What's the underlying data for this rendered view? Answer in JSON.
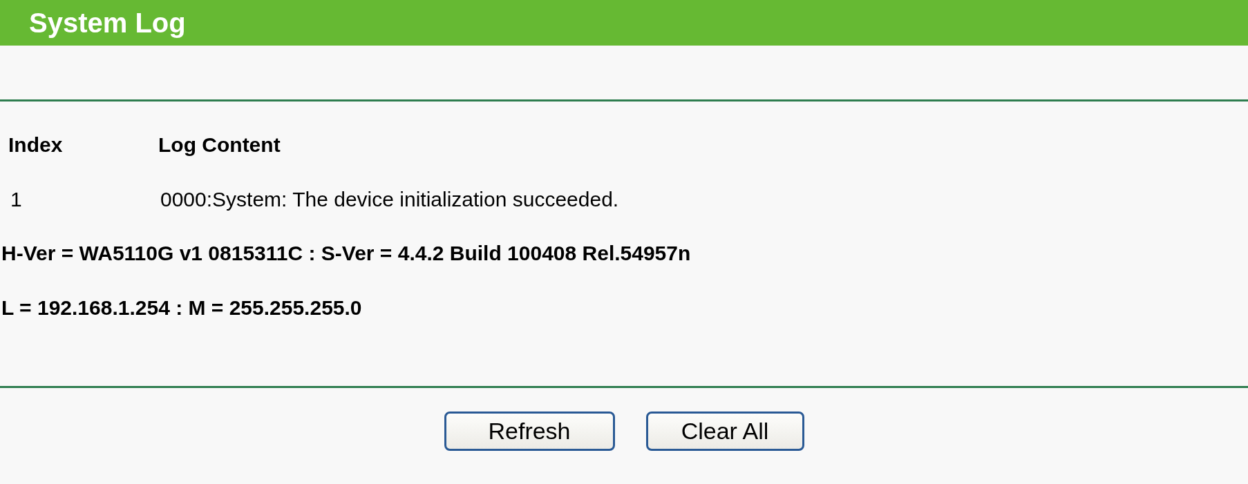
{
  "title": "System Log",
  "table": {
    "columns": [
      "Index",
      "Log Content"
    ],
    "rows": [
      {
        "index": "1",
        "content": "0000:System: The device initialization succeeded."
      }
    ]
  },
  "info_lines": [
    "H-Ver = WA5110G v1 0815311C : S-Ver = 4.4.2 Build 100408 Rel.54957n",
    "L = 192.168.1.254 : M = 255.255.255.0"
  ],
  "buttons": [
    "Refresh",
    "Clear All"
  ]
}
